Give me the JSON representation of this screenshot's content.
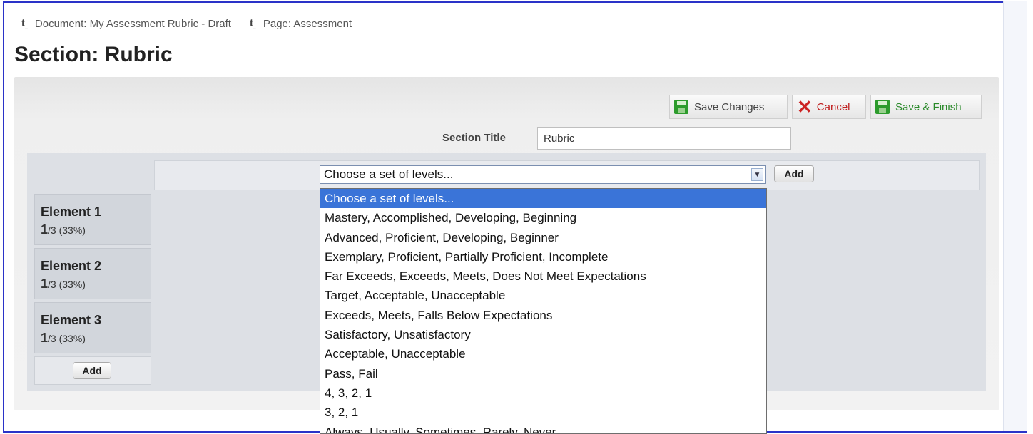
{
  "breadcrumbs": [
    {
      "label": "Document: My Assessment Rubric - Draft"
    },
    {
      "label": "Page: Assessment"
    }
  ],
  "page_title": "Section: Rubric",
  "toolbar": {
    "save_changes": "Save Changes",
    "cancel": "Cancel",
    "save_finish": "Save & Finish"
  },
  "section_title": {
    "label": "Section Title",
    "value": "Rubric"
  },
  "levels": {
    "selected": "Choose a set of levels...",
    "add_label": "Add",
    "options": [
      "Choose a set of levels...",
      "Mastery, Accomplished, Developing, Beginning",
      "Advanced, Proficient, Developing, Beginner",
      "Exemplary, Proficient, Partially Proficient, Incomplete",
      "Far Exceeds, Exceeds, Meets, Does Not Meet Expectations",
      "Target, Acceptable, Unacceptable",
      "Exceeds, Meets, Falls Below Expectations",
      "Satisfactory, Unsatisfactory",
      "Acceptable, Unacceptable",
      "Pass, Fail",
      "4, 3, 2, 1",
      "3, 2, 1",
      "Always, Usually, Sometimes, Rarely, Never"
    ]
  },
  "elements": [
    {
      "name": "Element 1",
      "count": "1",
      "rest": "/3 (33%)"
    },
    {
      "name": "Element 2",
      "count": "1",
      "rest": "/3 (33%)"
    },
    {
      "name": "Element 3",
      "count": "1",
      "rest": "/3 (33%)"
    }
  ],
  "elements_add_label": "Add",
  "colors": {
    "frame": "#2a33c8",
    "selected_option": "#3a74d8",
    "save_text": "#2a8a2a",
    "cancel_text": "#c02020"
  }
}
